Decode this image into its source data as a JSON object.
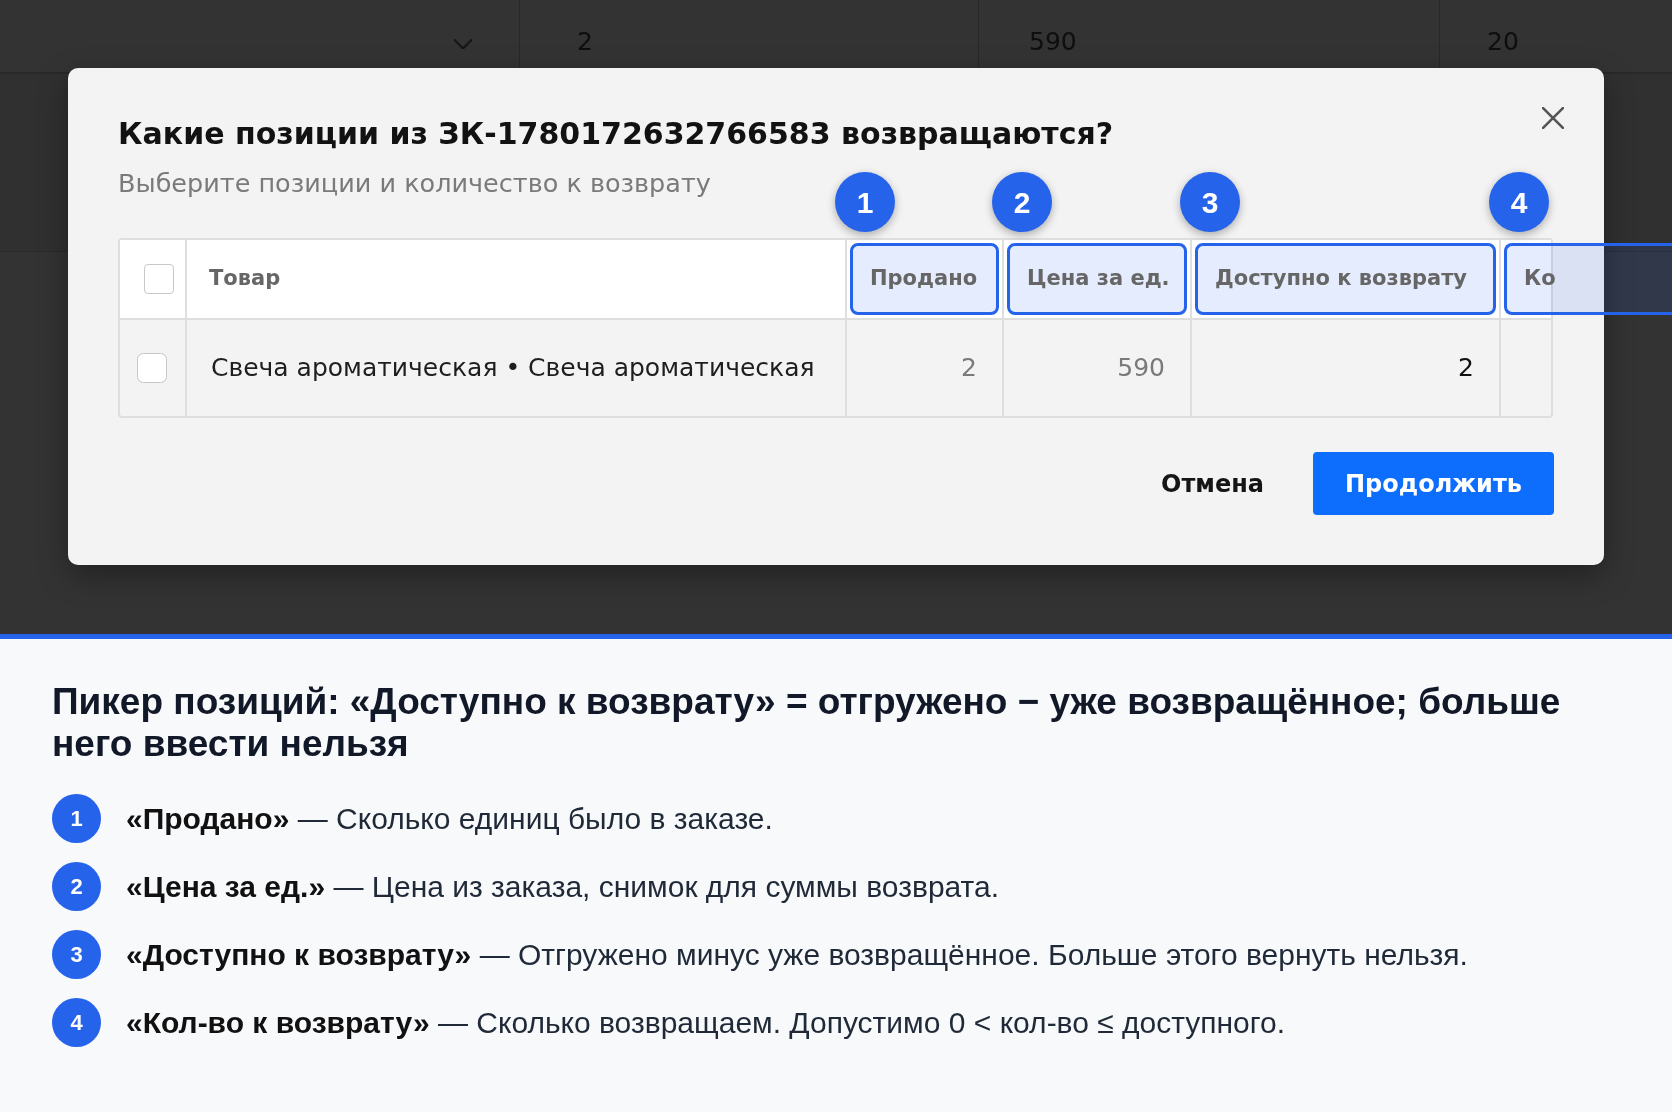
{
  "background_table": {
    "rows": [
      {
        "cells": [
          "2",
          "590",
          "20"
        ]
      }
    ]
  },
  "dialog": {
    "title": "Какие позиции из ЗК-1780172632766583 возвращаются?",
    "subtitle": "Выберите позиции и количество к возврату",
    "table": {
      "select_all": {
        "checked": false
      },
      "columns": [
        {
          "label": "Товар",
          "highlighted": false
        },
        {
          "label": "Продано",
          "highlighted": true,
          "callout": "1"
        },
        {
          "label": "Цена за ед.",
          "highlighted": true,
          "callout": "2"
        },
        {
          "label": "Доступно к возврату",
          "highlighted": true,
          "callout": "3"
        },
        {
          "label": "Ко",
          "highlighted": true,
          "callout": "4"
        }
      ],
      "rows": [
        {
          "checked": false,
          "cells": [
            "Свеча ароматическая • Свеча ароматическая",
            "2",
            "590",
            "2"
          ]
        }
      ]
    },
    "buttons": [
      {
        "label": "Отмена",
        "kind": "secondary"
      },
      {
        "label": "Продолжить",
        "kind": "primary"
      }
    ]
  },
  "annotation": {
    "title": "Пикер позиций: «Доступно к возврату» = отгружено − уже возвращённое; больше него ввести нельзя",
    "items": [
      {
        "number": "1",
        "text": "**«Продано»** — Сколько единиц было в заказе."
      },
      {
        "number": "2",
        "text": "**«Цена за ед.»** — Цена из заказа, снимок для суммы возврата."
      },
      {
        "number": "3",
        "text": "**«Доступно к возврату»** — Отгружено минус уже возвращённое. Больше этого вернуть нельзя."
      },
      {
        "number": "4",
        "text": "**«Кол-во к возврату»** — Сколько возвращаем. Допустимо 0 < кол-во ≤ доступного."
      }
    ]
  }
}
